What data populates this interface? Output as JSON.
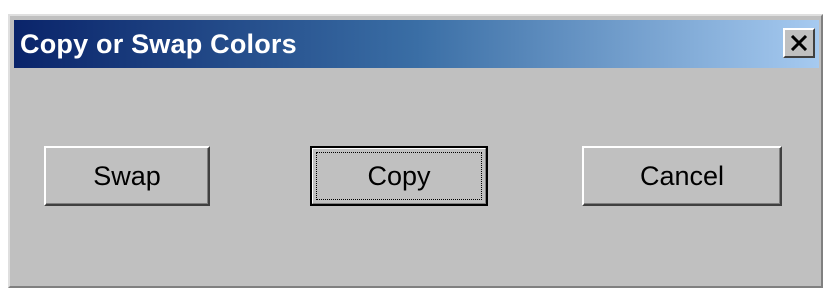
{
  "window": {
    "title": "Copy or Swap Colors",
    "close_icon": "close-x-icon"
  },
  "buttons": {
    "swap_label": "Swap",
    "copy_label": "Copy",
    "cancel_label": "Cancel"
  },
  "colors": {
    "title_gradient_start": "#0a246a",
    "title_gradient_end": "#a6caf0",
    "face": "#c0c0c0"
  }
}
